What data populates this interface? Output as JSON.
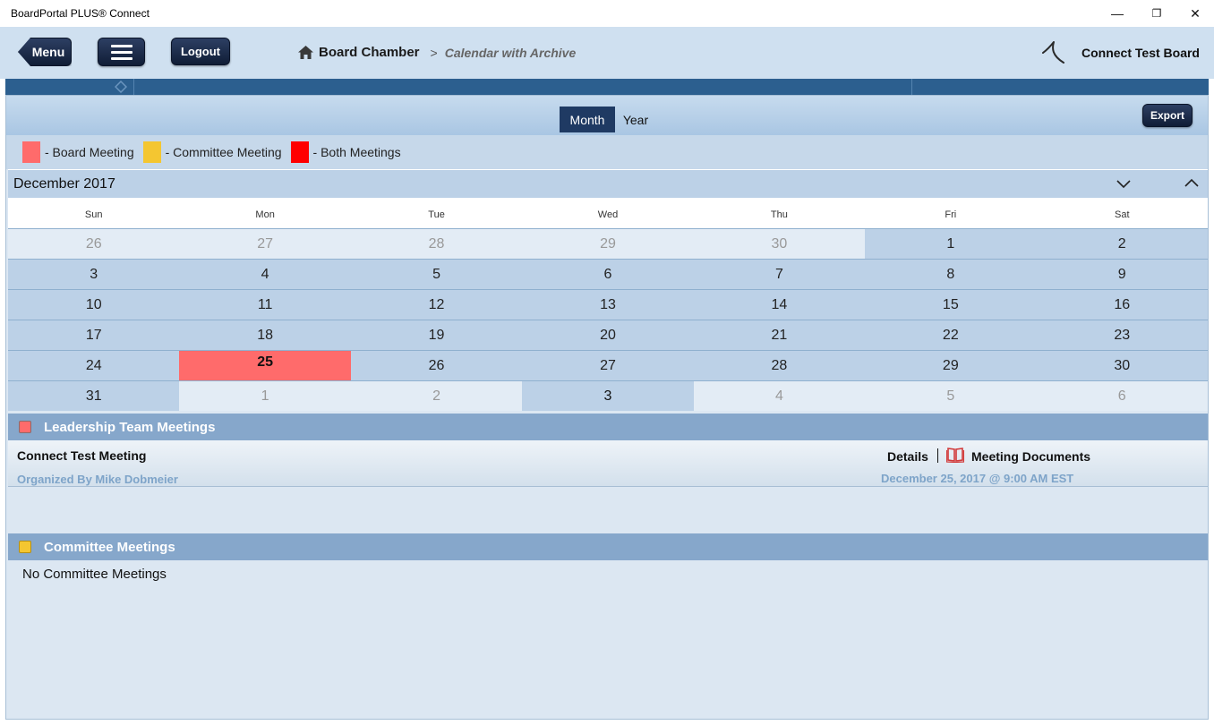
{
  "window": {
    "title": "BoardPortal PLUS® Connect",
    "minimize": "—",
    "restore": "❐",
    "close": "✕"
  },
  "header": {
    "menu_label": "Menu",
    "logout_label": "Logout",
    "breadcrumb": {
      "root": "Board Chamber",
      "separator": ">",
      "current": "Calendar with Archive"
    },
    "board_name": "Connect Test Board"
  },
  "view": {
    "month_label": "Month",
    "year_label": "Year",
    "active": "Month",
    "export_label": "Export"
  },
  "legend": [
    {
      "label": "- Board Meeting",
      "color": "#ff6b6b"
    },
    {
      "label": "- Committee Meeting",
      "color": "#f4c631"
    },
    {
      "label": "- Both Meetings",
      "color": "#ff0000"
    }
  ],
  "calendar": {
    "month_title": "December 2017",
    "weekdays": [
      "Sun",
      "Mon",
      "Tue",
      "Wed",
      "Thu",
      "Fri",
      "Sat"
    ],
    "weeks": [
      [
        "26",
        "27",
        "28",
        "29",
        "30",
        "1",
        "2"
      ],
      [
        "3",
        "4",
        "5",
        "6",
        "7",
        "8",
        "9"
      ],
      [
        "10",
        "11",
        "12",
        "13",
        "14",
        "15",
        "16"
      ],
      [
        "17",
        "18",
        "19",
        "20",
        "21",
        "22",
        "23"
      ],
      [
        "24",
        "25",
        "26",
        "27",
        "28",
        "29",
        "30"
      ],
      [
        "31",
        "1",
        "2",
        "3",
        "4",
        "5",
        "6"
      ]
    ]
  },
  "leadership": {
    "title": "Leadership Team Meetings",
    "meeting_name": "Connect Test Meeting",
    "organizer": "Organized By Mike Dobmeier",
    "details_label": "Details",
    "documents_label": "Meeting Documents",
    "datetime": "December 25, 2017 @ 9:00 AM EST"
  },
  "committee": {
    "title": "Committee Meetings",
    "empty_text": "No Committee Meetings"
  },
  "colors": {
    "board": "#ff6b6b",
    "committee": "#f4c631",
    "both": "#ff0000",
    "header_dark": "#1f3a63"
  }
}
